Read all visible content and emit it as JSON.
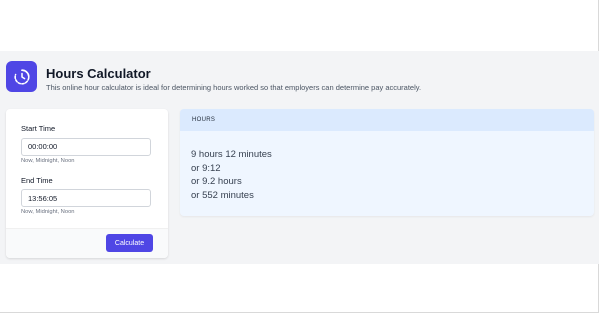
{
  "header": {
    "title": "Hours Calculator",
    "subtitle": "This online hour calculator is ideal for determining hours worked so that employers can determine pay accurately.",
    "icon": "clock-icon"
  },
  "form": {
    "start": {
      "label": "Start Time",
      "value": "00:00:00",
      "hints": [
        "Now",
        "Midnight",
        "Noon"
      ]
    },
    "end": {
      "label": "End Time",
      "value": "13:56:05",
      "hints": [
        "Now",
        "Midnight",
        "Noon"
      ]
    },
    "calculate_label": "Calculate"
  },
  "result": {
    "header": "HOURS",
    "lines": [
      "9 hours 12 minutes",
      "or 9:12",
      "or 9.2 hours",
      "or 552 minutes"
    ]
  },
  "colors": {
    "accent": "#4f46e5",
    "result_bg": "#eff6ff",
    "result_header_bg": "#dbeafe",
    "band_bg": "#f3f4f6"
  }
}
